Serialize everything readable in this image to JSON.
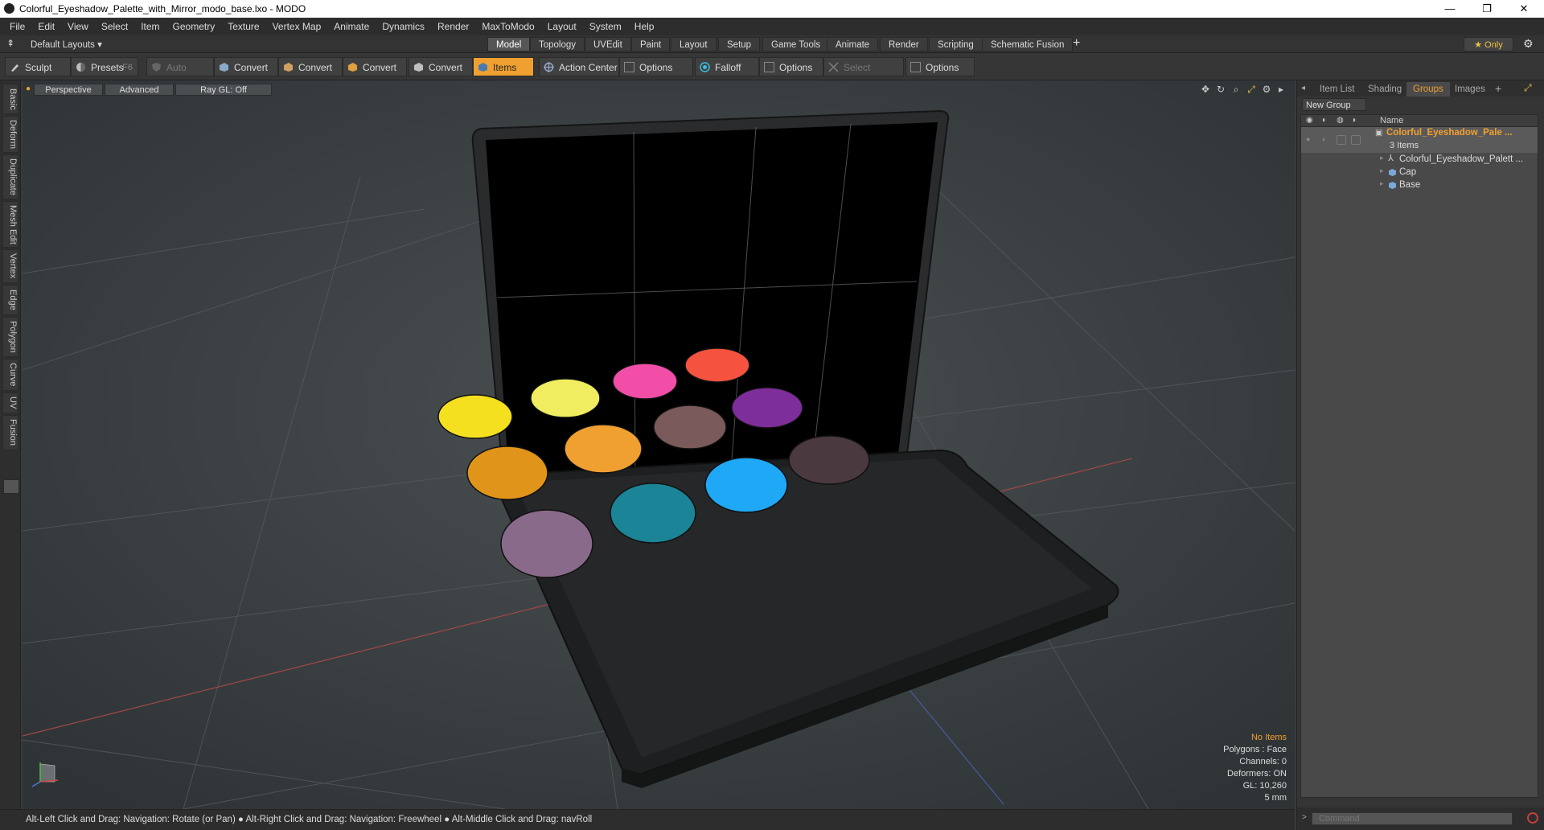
{
  "window": {
    "title": "Colorful_Eyeshadow_Palette_with_Mirror_modo_base.lxo - MODO",
    "minimize": "—",
    "maximize": "❐",
    "close": "✕"
  },
  "menu": [
    "File",
    "Edit",
    "View",
    "Select",
    "Item",
    "Geometry",
    "Texture",
    "Vertex Map",
    "Animate",
    "Dynamics",
    "Render",
    "MaxToModo",
    "Layout",
    "System",
    "Help"
  ],
  "layoutbar": {
    "layouts_label": "Default Layouts ▾",
    "tabs": [
      "Model",
      "Topology",
      "UVEdit",
      "Paint",
      "Layout",
      "Setup",
      "Game Tools",
      "Animate",
      "Render",
      "Scripting",
      "Schematic Fusion"
    ],
    "active_tab": "Model",
    "add": "+",
    "only_label": "★ Only",
    "gear": "⚙"
  },
  "toolbar": {
    "sculpt": "Sculpt",
    "presets": "Presets",
    "presets_hint": "F6",
    "auto_select": "Auto Select",
    "convert1": "Convert",
    "convert2": "Convert",
    "convert3": "Convert",
    "convert4": "Convert",
    "items": "Items",
    "action_center": "Action Center",
    "options1": "Options",
    "falloff": "Falloff",
    "options2": "Options",
    "select_through": "Select Through",
    "options3": "Options"
  },
  "left_tabs": [
    "Basic",
    "Deform",
    "Duplicate",
    "Mesh Edit",
    "Vertex",
    "Edge",
    "Polygon",
    "Curve",
    "UV",
    "Fusion"
  ],
  "viewport": {
    "perspective": "Perspective",
    "advanced": "Advanced",
    "raygl": "Ray GL: Off",
    "stats": {
      "items": "No Items",
      "polygons": "Polygons : Face",
      "channels": "Channels: 0",
      "deformers": "Deformers: ON",
      "gl": "GL: 10,260",
      "scale": "5 mm"
    },
    "swatch_colors": [
      "#f5e020",
      "#f0ee60",
      "#f24ea8",
      "#f5533f",
      "#7e2e9a",
      "#7a5a5a",
      "#f0a030",
      "#e0951a",
      "#4a3a40",
      "#1fa8f5",
      "#1b8496",
      "#8a6a8a"
    ]
  },
  "statusbar": {
    "text": "Alt-Left Click and Drag: Navigation: Rotate (or Pan) ● Alt-Right Click and Drag: Navigation: Freewheel ● Alt-Middle Click and Drag: navRoll"
  },
  "rightpanel": {
    "tabs": [
      "Item List",
      "Shading",
      "Groups",
      "Images"
    ],
    "active_tab": "Groups",
    "add": "+",
    "new_group": "New Group",
    "col_name": "Name",
    "group_name": "Colorful_Eyeshadow_Pale ...",
    "group_count": "3 Items",
    "children": [
      "Colorful_Eyeshadow_Palett ...",
      "Cap",
      "Base"
    ],
    "command_placeholder": "Command"
  }
}
